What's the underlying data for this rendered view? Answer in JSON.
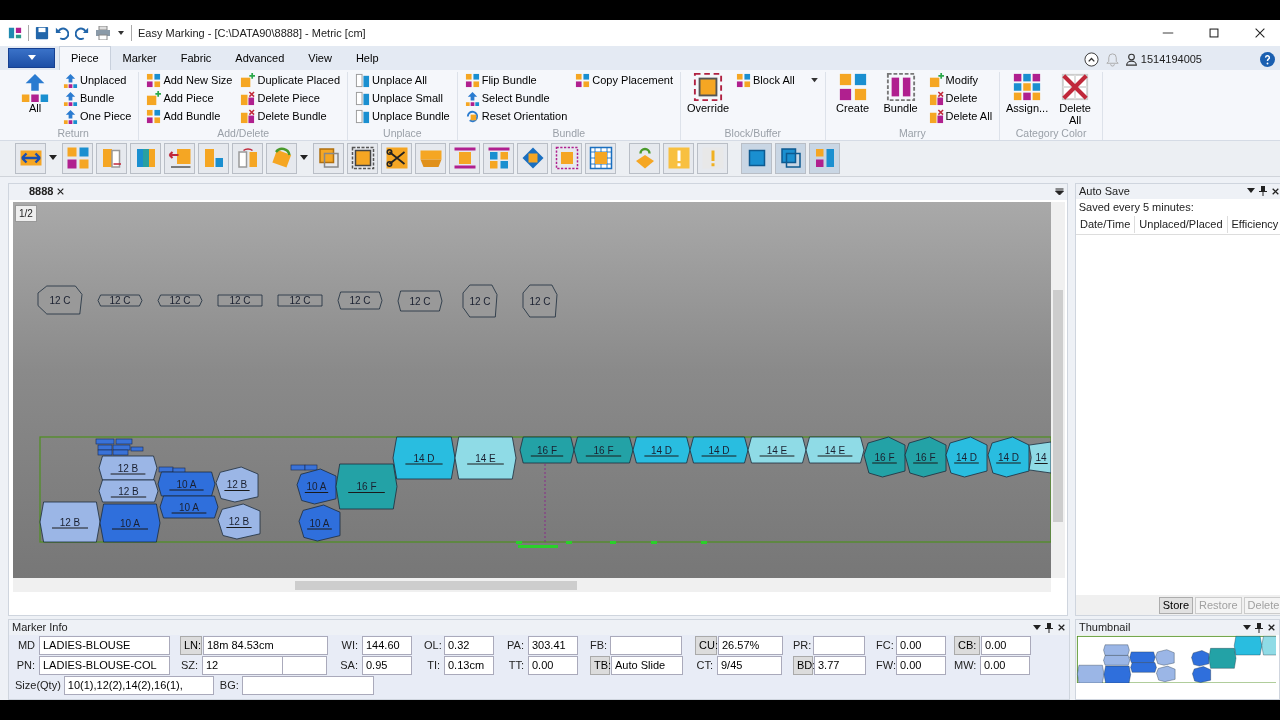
{
  "window": {
    "title": "Easy Marking - [C:\\DATA90\\8888] - Metric [cm]"
  },
  "ribbon": {
    "tabs": [
      {
        "label": "Piece",
        "selected": true
      },
      {
        "label": "Marker",
        "selected": false
      },
      {
        "label": "Fabric",
        "selected": false
      },
      {
        "label": "Advanced",
        "selected": false
      },
      {
        "label": "View",
        "selected": false
      },
      {
        "label": "Help",
        "selected": false
      }
    ],
    "user": "1514194005",
    "groups": [
      {
        "label": "Return",
        "items": [
          {
            "label": "All",
            "kind": "large"
          },
          {
            "label": "Unplaced",
            "kind": "small"
          },
          {
            "label": "Bundle",
            "kind": "small"
          },
          {
            "label": "One Piece",
            "kind": "small"
          }
        ]
      },
      {
        "label": "Add/Delete",
        "items": [
          {
            "label": "Add New Size",
            "kind": "small"
          },
          {
            "label": "Add Piece",
            "kind": "small"
          },
          {
            "label": "Add Bundle",
            "kind": "small"
          },
          {
            "label": "Duplicate Placed",
            "kind": "small"
          },
          {
            "label": "Delete Piece",
            "kind": "small"
          },
          {
            "label": "Delete Bundle",
            "kind": "small"
          }
        ]
      },
      {
        "label": "Unplace",
        "items": [
          {
            "label": "Unplace All",
            "kind": "small"
          },
          {
            "label": "Unplace Small",
            "kind": "small"
          },
          {
            "label": "Unplace Bundle",
            "kind": "small"
          }
        ]
      },
      {
        "label": "Bundle",
        "items": [
          {
            "label": "Flip Bundle",
            "kind": "small"
          },
          {
            "label": "Select Bundle",
            "kind": "small"
          },
          {
            "label": "Reset Orientation",
            "kind": "small"
          },
          {
            "label": "Copy Placement",
            "kind": "small"
          }
        ]
      },
      {
        "label": "Block/Buffer",
        "items": [
          {
            "label": "Override",
            "kind": "large"
          },
          {
            "label": "Block All",
            "kind": "small",
            "dropdown": true
          }
        ]
      },
      {
        "label": "Marry",
        "items": [
          {
            "label": "Create",
            "kind": "large"
          },
          {
            "label": "Bundle",
            "kind": "large"
          },
          {
            "label": "Modify",
            "kind": "small"
          },
          {
            "label": "Delete",
            "kind": "small"
          },
          {
            "label": "Delete All",
            "kind": "small"
          }
        ]
      },
      {
        "label": "Category Color",
        "items": [
          {
            "label": "Assign...",
            "kind": "large"
          },
          {
            "label": "Delete All",
            "kind": "large"
          }
        ]
      }
    ]
  },
  "document": {
    "tab": "8888",
    "page": "1/2"
  },
  "marker": {
    "pieces": [
      {
        "label": "12 C",
        "color": "#999999"
      },
      {
        "label": "12 C",
        "color": "#999999"
      },
      {
        "label": "12 C",
        "color": "#999999"
      },
      {
        "label": "12 C",
        "color": "#999999"
      },
      {
        "label": "12 C",
        "color": "#999999"
      },
      {
        "label": "12 C",
        "color": "#999999"
      },
      {
        "label": "12 C",
        "color": "#999999"
      },
      {
        "label": "12 C",
        "color": "#999999"
      },
      {
        "label": "12 C",
        "color": "#999999"
      },
      {
        "label": "14 D",
        "color": "#29bde0"
      },
      {
        "label": "14 E",
        "color": "#8fdbe6"
      },
      {
        "label": "16 F",
        "color": "#23a2a6"
      },
      {
        "label": "16 F",
        "color": "#23a2a6"
      },
      {
        "label": "14 D",
        "color": "#29bde0"
      },
      {
        "label": "14 D",
        "color": "#29bde0"
      },
      {
        "label": "14 E",
        "color": "#8fdbe6"
      },
      {
        "label": "14 E",
        "color": "#8fdbe6"
      },
      {
        "label": "16 F",
        "color": "#23a2a6"
      },
      {
        "label": "16 F",
        "color": "#23a2a6"
      },
      {
        "label": "14 D",
        "color": "#29bde0"
      },
      {
        "label": "14 D",
        "color": "#29bde0"
      },
      {
        "label": "14",
        "color": "#8fdbe6"
      },
      {
        "label": "12 B",
        "color": "#9bb6e6"
      },
      {
        "label": "10 A",
        "color": "#2f6fdc"
      },
      {
        "label": "12 B",
        "color": "#9bb6e6"
      },
      {
        "label": "10 A",
        "color": "#2f6fdc"
      },
      {
        "label": "16 F",
        "color": "#23a2a6"
      },
      {
        "label": "12 B",
        "color": "#9bb6e6"
      },
      {
        "label": "10 A",
        "color": "#2f6fdc"
      },
      {
        "label": "12 B",
        "color": "#9bb6e6"
      },
      {
        "label": "10 A",
        "color": "#2f6fdc"
      },
      {
        "label": "12 B",
        "color": "#9bb6e6"
      },
      {
        "label": "10 A",
        "color": "#2f6fdc"
      }
    ]
  },
  "auto_save": {
    "title": "Auto Save",
    "note": "Saved every 5 minutes:",
    "columns": [
      "Date/Time",
      "Unplaced/Placed",
      "Efficiency"
    ],
    "buttons": [
      {
        "label": "Store",
        "disabled": false
      },
      {
        "label": "Restore",
        "disabled": true
      },
      {
        "label": "Delete",
        "disabled": true
      }
    ]
  },
  "marker_info": {
    "title": "Marker Info",
    "columns": [
      [
        {
          "label": "MD",
          "value": "LADIES-BLOUSE",
          "kind": "plain"
        },
        {
          "label": "PN:",
          "value": "LADIES-BLOUSE-COL",
          "kind": "plain"
        }
      ],
      [
        {
          "label": "LN:",
          "value": "18m 84.53cm",
          "kind": "button"
        },
        {
          "label": "SZ:",
          "value": "12",
          "kind": "plain",
          "extra_box": true
        }
      ],
      [
        {
          "label": "WI:",
          "value": "144.60",
          "kind": "plain"
        },
        {
          "label": "SA:",
          "value": "0.95",
          "kind": "plain"
        }
      ],
      [
        {
          "label": "OL:",
          "value": "0.32",
          "kind": "plain"
        },
        {
          "label": "TI:",
          "value": "0.13cm",
          "kind": "plain"
        }
      ],
      [
        {
          "label": "PA:",
          "value": "303.41",
          "kind": "plain"
        },
        {
          "label": "TT:",
          "value": "0.00",
          "kind": "plain"
        }
      ],
      [
        {
          "label": "FB:",
          "kind": "plain"
        },
        {
          "label": "TB:",
          "value": "Auto Slide",
          "kind": "button"
        }
      ],
      [
        {
          "label": "CU:",
          "value": "26.57%",
          "kind": "button"
        },
        {
          "label": "CT:",
          "value": "9/45",
          "kind": "plain"
        }
      ],
      [
        {
          "label": "PR:",
          "kind": "plain"
        },
        {
          "label": "BD:",
          "value": "3.77",
          "kind": "button"
        }
      ],
      [
        {
          "label": "FC:",
          "value": "0.00",
          "kind": "plain"
        },
        {
          "label": "FW:",
          "value": "0.00",
          "kind": "plain"
        }
      ],
      [
        {
          "label": "CB:",
          "value": "0.00",
          "kind": "button"
        },
        {
          "label": "MW:",
          "value": "0.00",
          "kind": "plain"
        }
      ]
    ],
    "extra_row": [
      {
        "label": "Size(Qty)",
        "value": "10(1),12(2),14(2),16(1),"
      },
      {
        "label": "BG:"
      }
    ]
  },
  "thumbnail": {
    "title": "Thumbnail"
  }
}
